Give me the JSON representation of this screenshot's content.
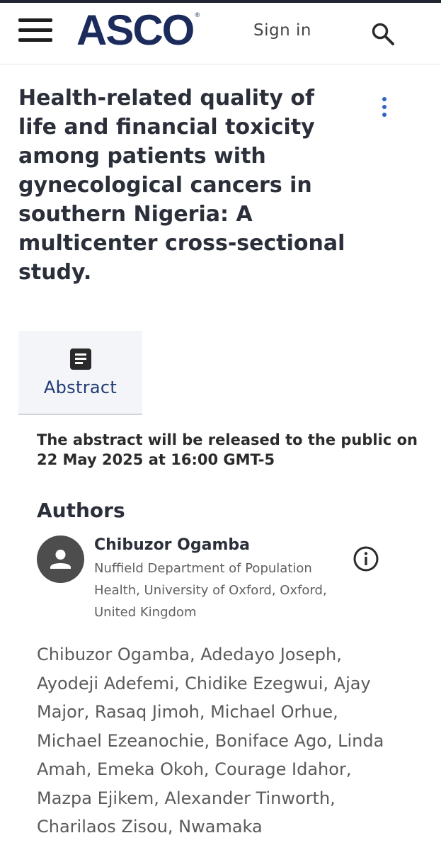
{
  "header": {
    "logo_text": "ASCO",
    "logo_reg": "®",
    "signin_label": "Sign in",
    "brand_color": "#1b2c5c",
    "icons": [
      "menu-icon",
      "search-icon"
    ]
  },
  "article": {
    "title": "Health-related quality of life and financial toxicity among patients with gynecological cancers in southern Nigeria: A multicenter cross-sectional study.",
    "menu_icon": "more-vertical-icon"
  },
  "tabs": {
    "abstract_label": "Abstract",
    "abstract_icon": "article-icon"
  },
  "abstract_notice": "The abstract will be released to the public on 22 May 2025 at 16:00 GMT-5",
  "authors": {
    "heading": "Authors",
    "primary": {
      "name": "Chibuzor Ogamba",
      "affiliation": "Nuffield Department of Population Health, University of Oxford, Oxford, United Kingdom",
      "avatar_icon": "person-icon",
      "info_icon": "info-icon"
    },
    "list": "Chibuzor Ogamba, Adedayo Joseph, Ayodeji Adefemi, Chidike Ezegwui, Ajay Major, Rasaq Jimoh, Michael Orhue, Michael Ezeanochie, Boniface Ago, Linda Amah, Emeka Okoh, Courage Idahor, Mazpa Ejikem, Alexander Tinworth, Charilaos Zisou, Nwamaka"
  },
  "colors": {
    "accent_blue": "#2e63c8",
    "tab_label": "#1f3b73"
  }
}
